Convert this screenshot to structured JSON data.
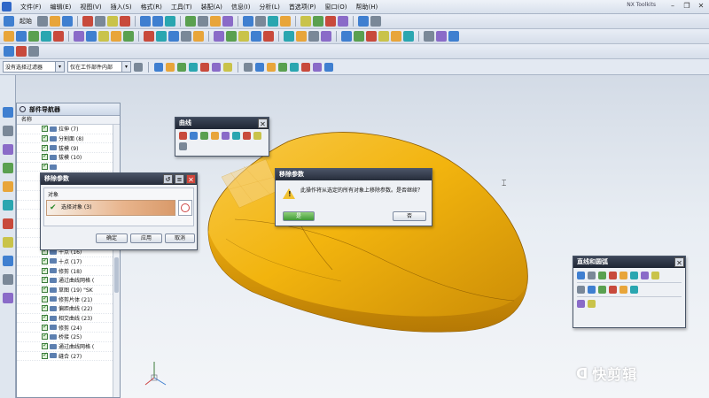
{
  "menubar": {
    "items": [
      "文件(F)",
      "编辑(E)",
      "视图(V)",
      "插入(S)",
      "格式(R)",
      "工具(T)",
      "装配(A)",
      "信息(I)",
      "分析(L)",
      "首选项(P)",
      "窗口(O)",
      "帮助(H)"
    ],
    "start_button": "起始",
    "app_title": "NX Toolkits"
  },
  "selbar": {
    "filter_value": "没有选择过滤器",
    "scope_value": "仅在工作部件内部"
  },
  "navigator": {
    "title": "部件导航器",
    "column_header": "名称",
    "rows": [
      "拉伸 (7)",
      "分割面 (8)",
      "拔模 (9)",
      "拔模 (10)",
      "",
      "",
      "",
      "",
      "",
      "",
      "",
      "",
      "",
      "十点 (16)",
      "十点 (17)",
      "修剪 (18)",
      "通过曲线网格 (",
      "草图 (19) \"SK",
      "修剪片体 (21)",
      "偏距曲线 (22)",
      "相交曲线 (23)",
      "修剪 (24)",
      "桥接 (25)",
      "通过曲线网格 (",
      "缝合 (27)"
    ]
  },
  "curve_dialog": {
    "title": "曲线"
  },
  "remove_dialog": {
    "title": "移除参数",
    "group_label": "对象",
    "select_object": "选择对象 (3)",
    "ok": "确定",
    "apply": "应用",
    "cancel": "取消"
  },
  "confirm_dialog": {
    "title": "移除参数",
    "message": "此操作将从选定的所有对象上移除参数。是否继续？",
    "yes": "是",
    "no": "否"
  },
  "straight_dialog": {
    "title": "直线和圆弧"
  },
  "watermark": "快剪辑",
  "colors": {
    "model": "#f2b40e",
    "model_shadow": "#c98a06",
    "dialog_title": "#262d3a",
    "select_highlight": "#e8b48c"
  }
}
